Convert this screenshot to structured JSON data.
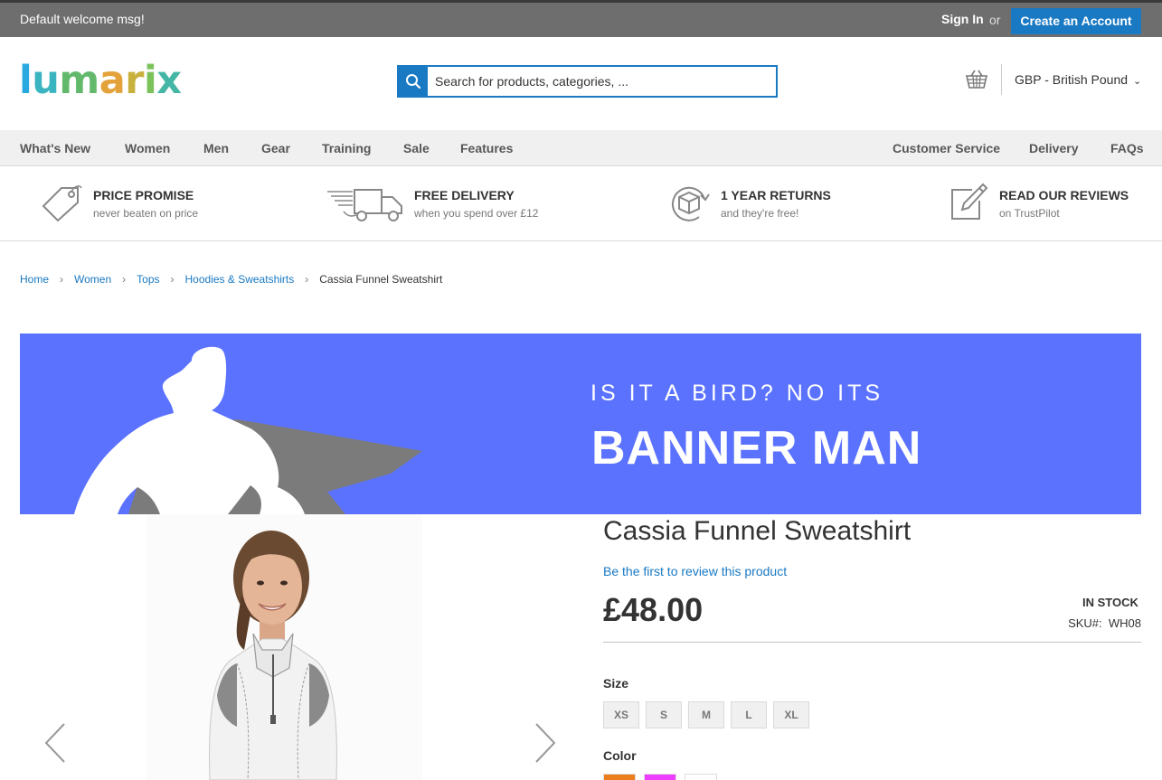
{
  "topbar": {
    "welcome": "Default welcome msg!",
    "sign_in": "Sign In",
    "or": "or",
    "create_account": "Create an Account"
  },
  "header": {
    "logo_text": "lumarix",
    "search_placeholder": "Search for products, categories, ...",
    "currency": "GBP - British Pound"
  },
  "nav": {
    "left": [
      "What's New",
      "Women",
      "Men",
      "Gear",
      "Training",
      "Sale",
      "Features"
    ],
    "right": [
      "Customer Service",
      "Delivery",
      "FAQs"
    ]
  },
  "promises": [
    {
      "title": "PRICE PROMISE",
      "subtitle": "never beaten on price",
      "icon": "price-tag-icon"
    },
    {
      "title": "FREE DELIVERY",
      "subtitle": "when you spend over £12",
      "icon": "delivery-truck-icon"
    },
    {
      "title": "1 YEAR RETURNS",
      "subtitle": "and they're free!",
      "icon": "returns-box-icon"
    },
    {
      "title": "READ OUR REVIEWS",
      "subtitle": "on TrustPilot",
      "icon": "review-pencil-icon"
    }
  ],
  "breadcrumb": {
    "items": [
      "Home",
      "Women",
      "Tops",
      "Hoodies & Sweatshirts"
    ],
    "current": "Cassia Funnel Sweatshirt"
  },
  "banner": {
    "tagline": "IS IT A BIRD? NO ITS",
    "headline": "BANNER MAN",
    "bg_color": "#5b72fe"
  },
  "product": {
    "name": "Cassia Funnel Sweatshirt",
    "review_link": "Be the first to review this product",
    "price": "£48.00",
    "stock": "IN STOCK",
    "sku_label": "SKU#:",
    "sku": "WH08",
    "size_label": "Size",
    "sizes": [
      "XS",
      "S",
      "M",
      "L",
      "XL"
    ],
    "color_label": "Color",
    "colors": [
      "#ec7d1c",
      "#ef3dff",
      "#ffffff"
    ]
  },
  "colors": {
    "accent": "#1979c3",
    "topbar": "#6e6e6e"
  }
}
